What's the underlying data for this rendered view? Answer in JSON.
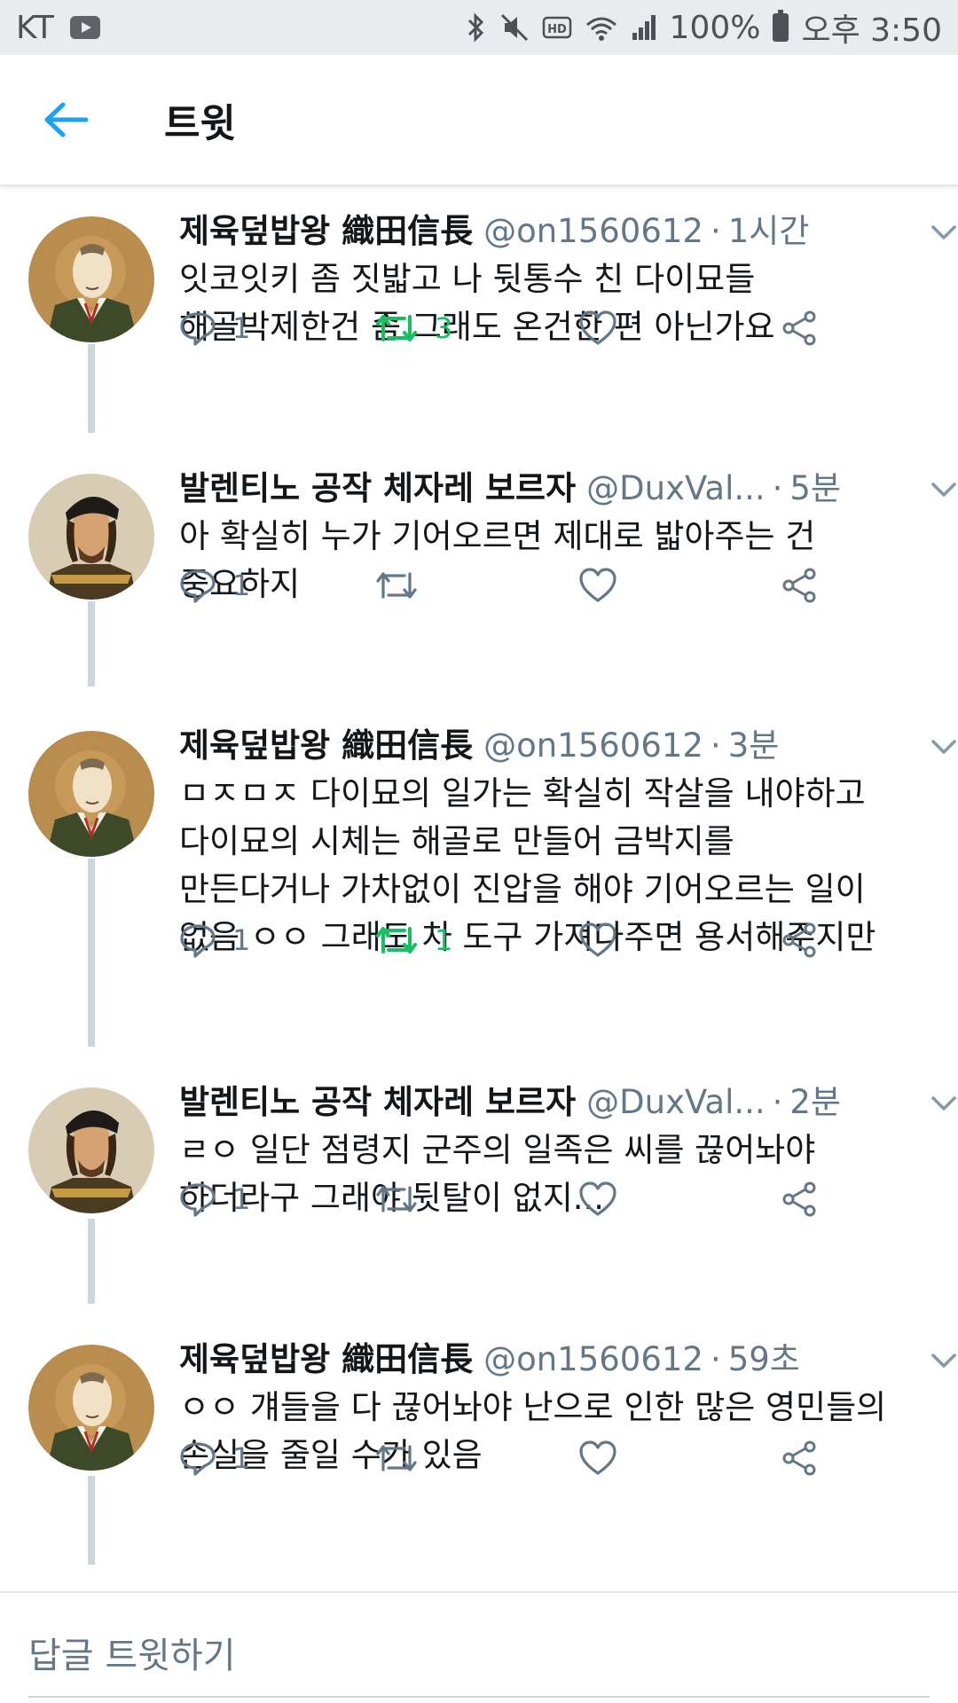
{
  "status_bar": {
    "carrier": "KT",
    "battery": "100%",
    "time": "오후 3:50"
  },
  "header": {
    "title": "트윗"
  },
  "tweets": [
    {
      "name": "제육덮밥왕 織田信長",
      "handle": "@on1560612",
      "time": "1시간",
      "text": "잇코잇키 좀 짓밟고 나 뒷통수 친 다이묘들\n해골박제한건 좀 그래도 온건한 편 아닌가요",
      "replies": "1",
      "retweets": "3",
      "retweeted": true,
      "avatar": "nobunaga"
    },
    {
      "name": "발렌티노 공작 체자레 보르자",
      "handle": "@DuxVal...",
      "time": "5분",
      "text": "아 확실히 누가 기어오르면 제대로 밟아주는 건\n중요하지",
      "replies": "1",
      "retweets": "",
      "retweeted": false,
      "avatar": "cesare"
    },
    {
      "name": "제육덮밥왕 織田信長",
      "handle": "@on1560612",
      "time": "3분",
      "text": "ㅁㅈㅁㅈ 다이묘의 일가는 확실히 작살을 내야하고\n다이묘의 시체는 해골로 만들어 금박지를\n만든다거나 가차없이 진압을 해야 기어오르는 일이\n없음 ㅇㅇ 그래도 차 도구 가져다주면 용서해주지만",
      "replies": "1",
      "retweets": "1",
      "retweeted": true,
      "avatar": "nobunaga"
    },
    {
      "name": "발렌티노 공작 체자레 보르자",
      "handle": "@DuxVal...",
      "time": "2분",
      "text": "ㄹㅇ 일단 점령지 군주의 일족은 씨를 끊어놔야\n하더라구 그래야 뒷탈이 없지...",
      "replies": "1",
      "retweets": "",
      "retweeted": false,
      "avatar": "cesare"
    },
    {
      "name": "제육덮밥왕 織田信長",
      "handle": "@on1560612",
      "time": "59초",
      "text": "ㅇㅇ 걔들을 다 끊어놔야 난으로 인한 많은 영민들의\n손실을 줄일 수가 있음",
      "replies": "1",
      "retweets": "",
      "retweeted": false,
      "avatar": "nobunaga"
    }
  ],
  "reply_bar": {
    "placeholder": "답글 트윗하기"
  },
  "colors": {
    "accent": "#1da1f2",
    "retweet_green": "#17bf63",
    "secondary_text": "#657786",
    "thread_line": "#ccd6dd"
  }
}
